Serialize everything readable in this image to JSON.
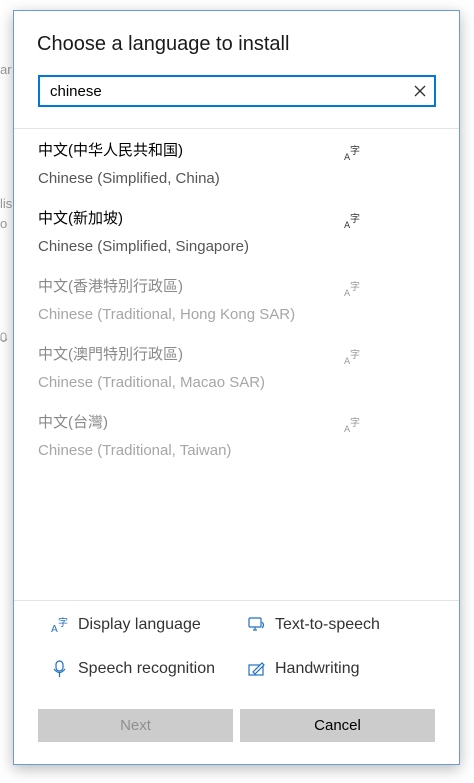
{
  "background": {
    "fragments": [
      "ar",
      "lis",
      "o"
    ]
  },
  "dialog": {
    "title": "Choose a language to install",
    "search": {
      "value": "chinese",
      "placeholder": ""
    },
    "languages": [
      {
        "native": "中文(中华人民共和国)",
        "english": "Chinese (Simplified, China)",
        "enabled": true
      },
      {
        "native": "中文(新加坡)",
        "english": "Chinese (Simplified, Singapore)",
        "enabled": true
      },
      {
        "native": "中文(香港特別行政區)",
        "english": "Chinese (Traditional, Hong Kong SAR)",
        "enabled": false
      },
      {
        "native": "中文(澳門特別行政區)",
        "english": "Chinese (Traditional, Macao SAR)",
        "enabled": false
      },
      {
        "native": "中文(台灣)",
        "english": "Chinese (Traditional, Taiwan)",
        "enabled": false
      }
    ],
    "features": {
      "display_language": "Display language",
      "text_to_speech": "Text-to-speech",
      "speech_recognition": "Speech recognition",
      "handwriting": "Handwriting"
    },
    "buttons": {
      "next": "Next",
      "cancel": "Cancel"
    },
    "colors": {
      "accent": "#0078d7",
      "button_bg": "#cccccc"
    }
  }
}
